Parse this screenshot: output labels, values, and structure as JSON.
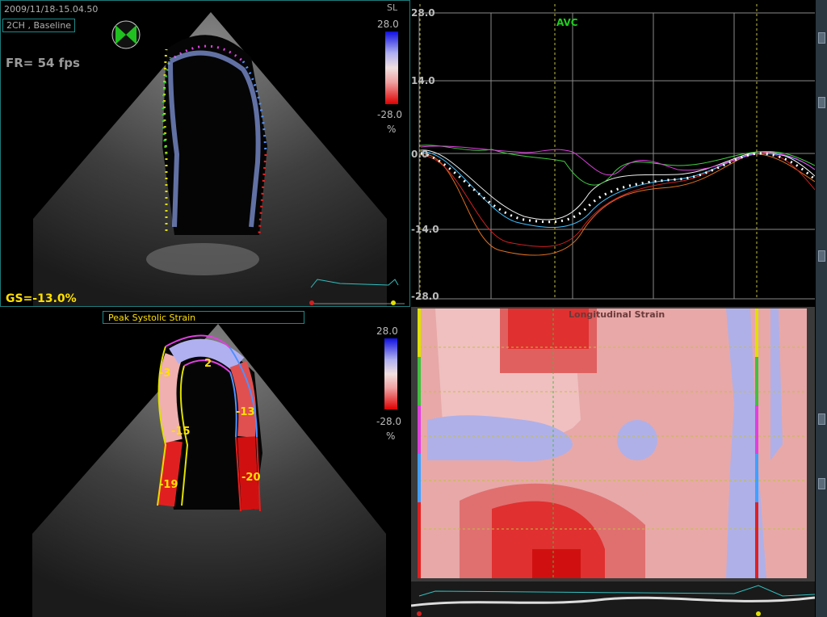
{
  "echo_top": {
    "timestamp": "2009/11/18-15.04.50",
    "view": "2CH , Baseline",
    "frame_rate": "FR=  54 fps",
    "global_strain": "GS=-13.0%",
    "scale_name": "SL",
    "scale_max": "28.0",
    "scale_min": "-28.0",
    "scale_unit": "%"
  },
  "echo_bottom": {
    "title": "Peak Systolic Strain",
    "scale_max": "28.0",
    "scale_min": "-28.0",
    "scale_unit": "%",
    "segment_values": [
      "-3",
      "2",
      "-13",
      "-15",
      "-19",
      "-20"
    ]
  },
  "strain_curves": {
    "marker": "AVC",
    "y_ticks": [
      "28.0",
      "14.0",
      "0.0",
      "-14.0",
      "-28.0"
    ]
  },
  "colour_map": {
    "title": "Longitudinal Strain"
  },
  "colors": {
    "panel_border": "#1e8a8a",
    "highlight_yellow": "#ffe000",
    "avc_green": "#1ecf1e",
    "strain_blue": "#2050ff",
    "strain_red": "#ff2020"
  }
}
